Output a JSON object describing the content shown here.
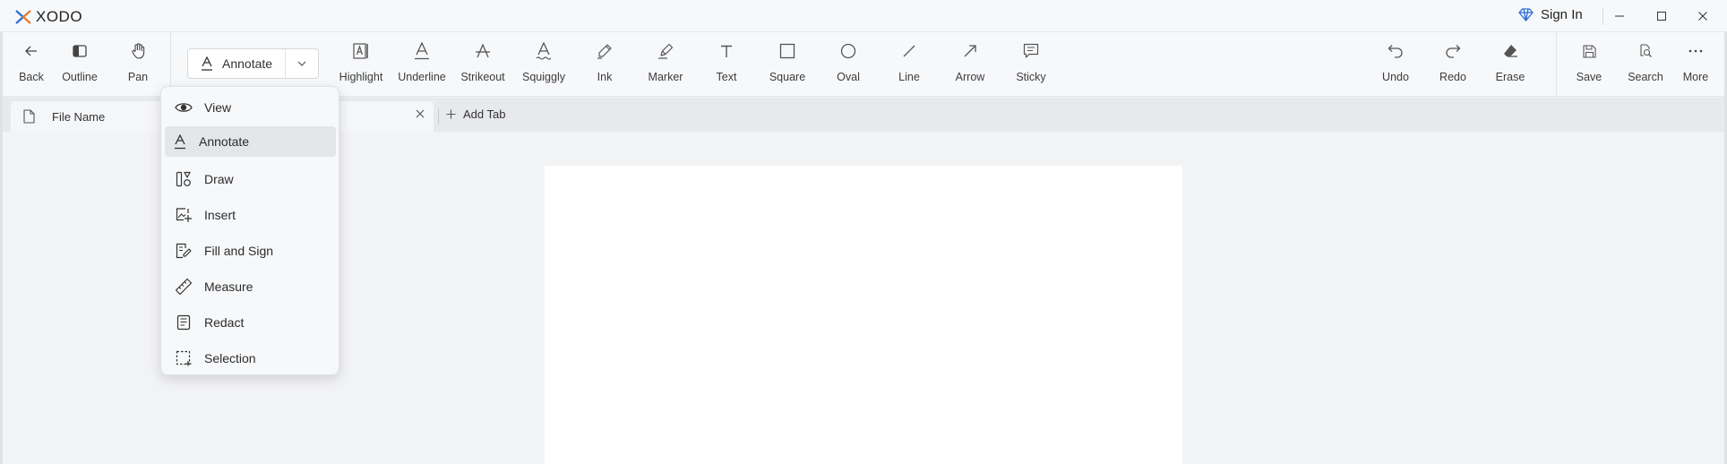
{
  "app": {
    "name": "XODO",
    "sign_in": "Sign In"
  },
  "toolbar": {
    "left": [
      {
        "label": "Back",
        "icon": "back-arrow-icon"
      },
      {
        "label": "Outline",
        "icon": "outline-panel-icon"
      },
      {
        "label": "Pan",
        "icon": "hand-icon"
      }
    ],
    "mode": {
      "selected": "Annotate"
    },
    "tools": [
      {
        "label": "Highlight",
        "icon": "highlight-icon"
      },
      {
        "label": "Underline",
        "icon": "underline-icon"
      },
      {
        "label": "Strikeout",
        "icon": "strikeout-icon"
      },
      {
        "label": "Squiggly",
        "icon": "squiggly-icon"
      },
      {
        "label": "Ink",
        "icon": "pen-icon"
      },
      {
        "label": "Marker",
        "icon": "marker-icon"
      },
      {
        "label": "Text",
        "icon": "text-icon"
      },
      {
        "label": "Square",
        "icon": "square-icon"
      },
      {
        "label": "Oval",
        "icon": "oval-icon"
      },
      {
        "label": "Line",
        "icon": "line-icon"
      },
      {
        "label": "Arrow",
        "icon": "arrow-icon"
      },
      {
        "label": "Sticky",
        "icon": "sticky-note-icon"
      }
    ],
    "right": [
      {
        "label": "Undo",
        "icon": "undo-icon"
      },
      {
        "label": "Redo",
        "icon": "redo-icon"
      },
      {
        "label": "Erase",
        "icon": "eraser-icon"
      },
      {
        "label": "Save",
        "icon": "save-icon"
      },
      {
        "label": "Search",
        "icon": "search-icon"
      },
      {
        "label": "More",
        "icon": "more-icon"
      }
    ]
  },
  "tabs": {
    "file_name": "File Name",
    "add_tab": "Add Tab"
  },
  "menu": {
    "items": [
      {
        "label": "View",
        "icon": "eye-icon"
      },
      {
        "label": "Annotate",
        "icon": "annotate-icon",
        "active": true
      },
      {
        "label": "Draw",
        "icon": "draw-shapes-icon"
      },
      {
        "label": "Insert",
        "icon": "insert-image-icon"
      },
      {
        "label": "Fill and Sign",
        "icon": "fill-sign-icon"
      },
      {
        "label": "Measure",
        "icon": "ruler-icon"
      },
      {
        "label": "Redact",
        "icon": "redact-icon"
      },
      {
        "label": "Selection",
        "icon": "selection-icon"
      }
    ]
  },
  "colors": {
    "accent": "#2b6cd4",
    "toolbar_bg": "#f7f8fa",
    "canvas_bg": "#f2f3f5"
  }
}
